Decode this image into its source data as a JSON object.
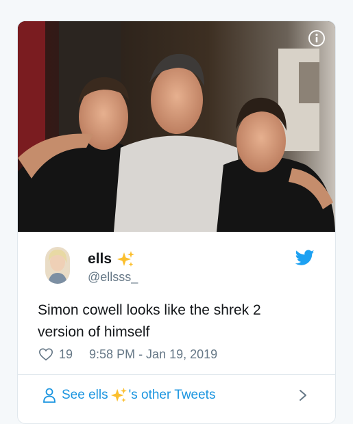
{
  "tweet": {
    "display_name": "ells",
    "display_name_emoji": "sparkles-emoji",
    "handle": "@ellsss_",
    "text_line1": "Simon cowell looks like the shrek 2",
    "text_line2": "version of himself",
    "like_count": "19",
    "timestamp": "9:58 PM - Jan 19, 2019"
  },
  "footer": {
    "see_prefix": "See ells",
    "see_suffix": "'s other Tweets"
  },
  "icons": {
    "info": "info-icon",
    "platform": "twitter-bird-icon",
    "like": "heart-icon",
    "profile": "person-icon",
    "more": "chevron-right-icon"
  },
  "colors": {
    "link": "#1b95e0",
    "secondary_text": "#657786",
    "primary_text": "#14171a",
    "border": "#e1e8ed",
    "background": "#f5f8fa",
    "sparkle": "#fbbf2e"
  }
}
